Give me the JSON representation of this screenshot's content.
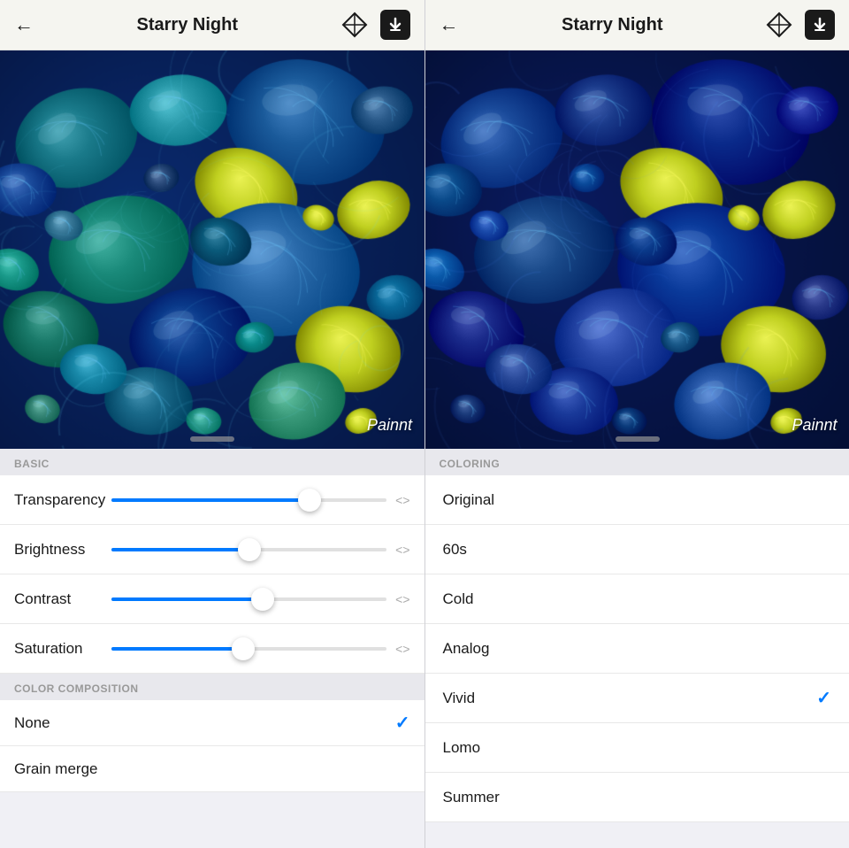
{
  "left": {
    "header": {
      "title": "Starry Night",
      "back_label": "←"
    },
    "watermark": "Painnt",
    "drag_handle": true,
    "section_basic": "BASIC",
    "sliders": [
      {
        "label": "Transparency",
        "fill_pct": 72,
        "thumb_pct": 72
      },
      {
        "label": "Brightness",
        "fill_pct": 50,
        "thumb_pct": 50
      },
      {
        "label": "Contrast",
        "fill_pct": 55,
        "thumb_pct": 55
      },
      {
        "label": "Saturation",
        "fill_pct": 48,
        "thumb_pct": 48
      }
    ],
    "section_color": "COLOR COMPOSITION",
    "composition_items": [
      {
        "label": "None",
        "checked": true
      },
      {
        "label": "Grain merge",
        "checked": false
      }
    ]
  },
  "right": {
    "header": {
      "title": "Starry Night",
      "back_label": "←"
    },
    "watermark": "Painnt",
    "section_coloring": "COLORING",
    "coloring_items": [
      {
        "label": "Original",
        "checked": false
      },
      {
        "label": "60s",
        "checked": false
      },
      {
        "label": "Cold",
        "checked": false
      },
      {
        "label": "Analog",
        "checked": false
      },
      {
        "label": "Vivid",
        "checked": true
      },
      {
        "label": "Lomo",
        "checked": false
      },
      {
        "label": "Summer",
        "checked": false
      }
    ]
  },
  "icons": {
    "back": "←",
    "diamond": "◇",
    "download": "⬇",
    "checkmark": "✓",
    "arrows": "<>"
  }
}
